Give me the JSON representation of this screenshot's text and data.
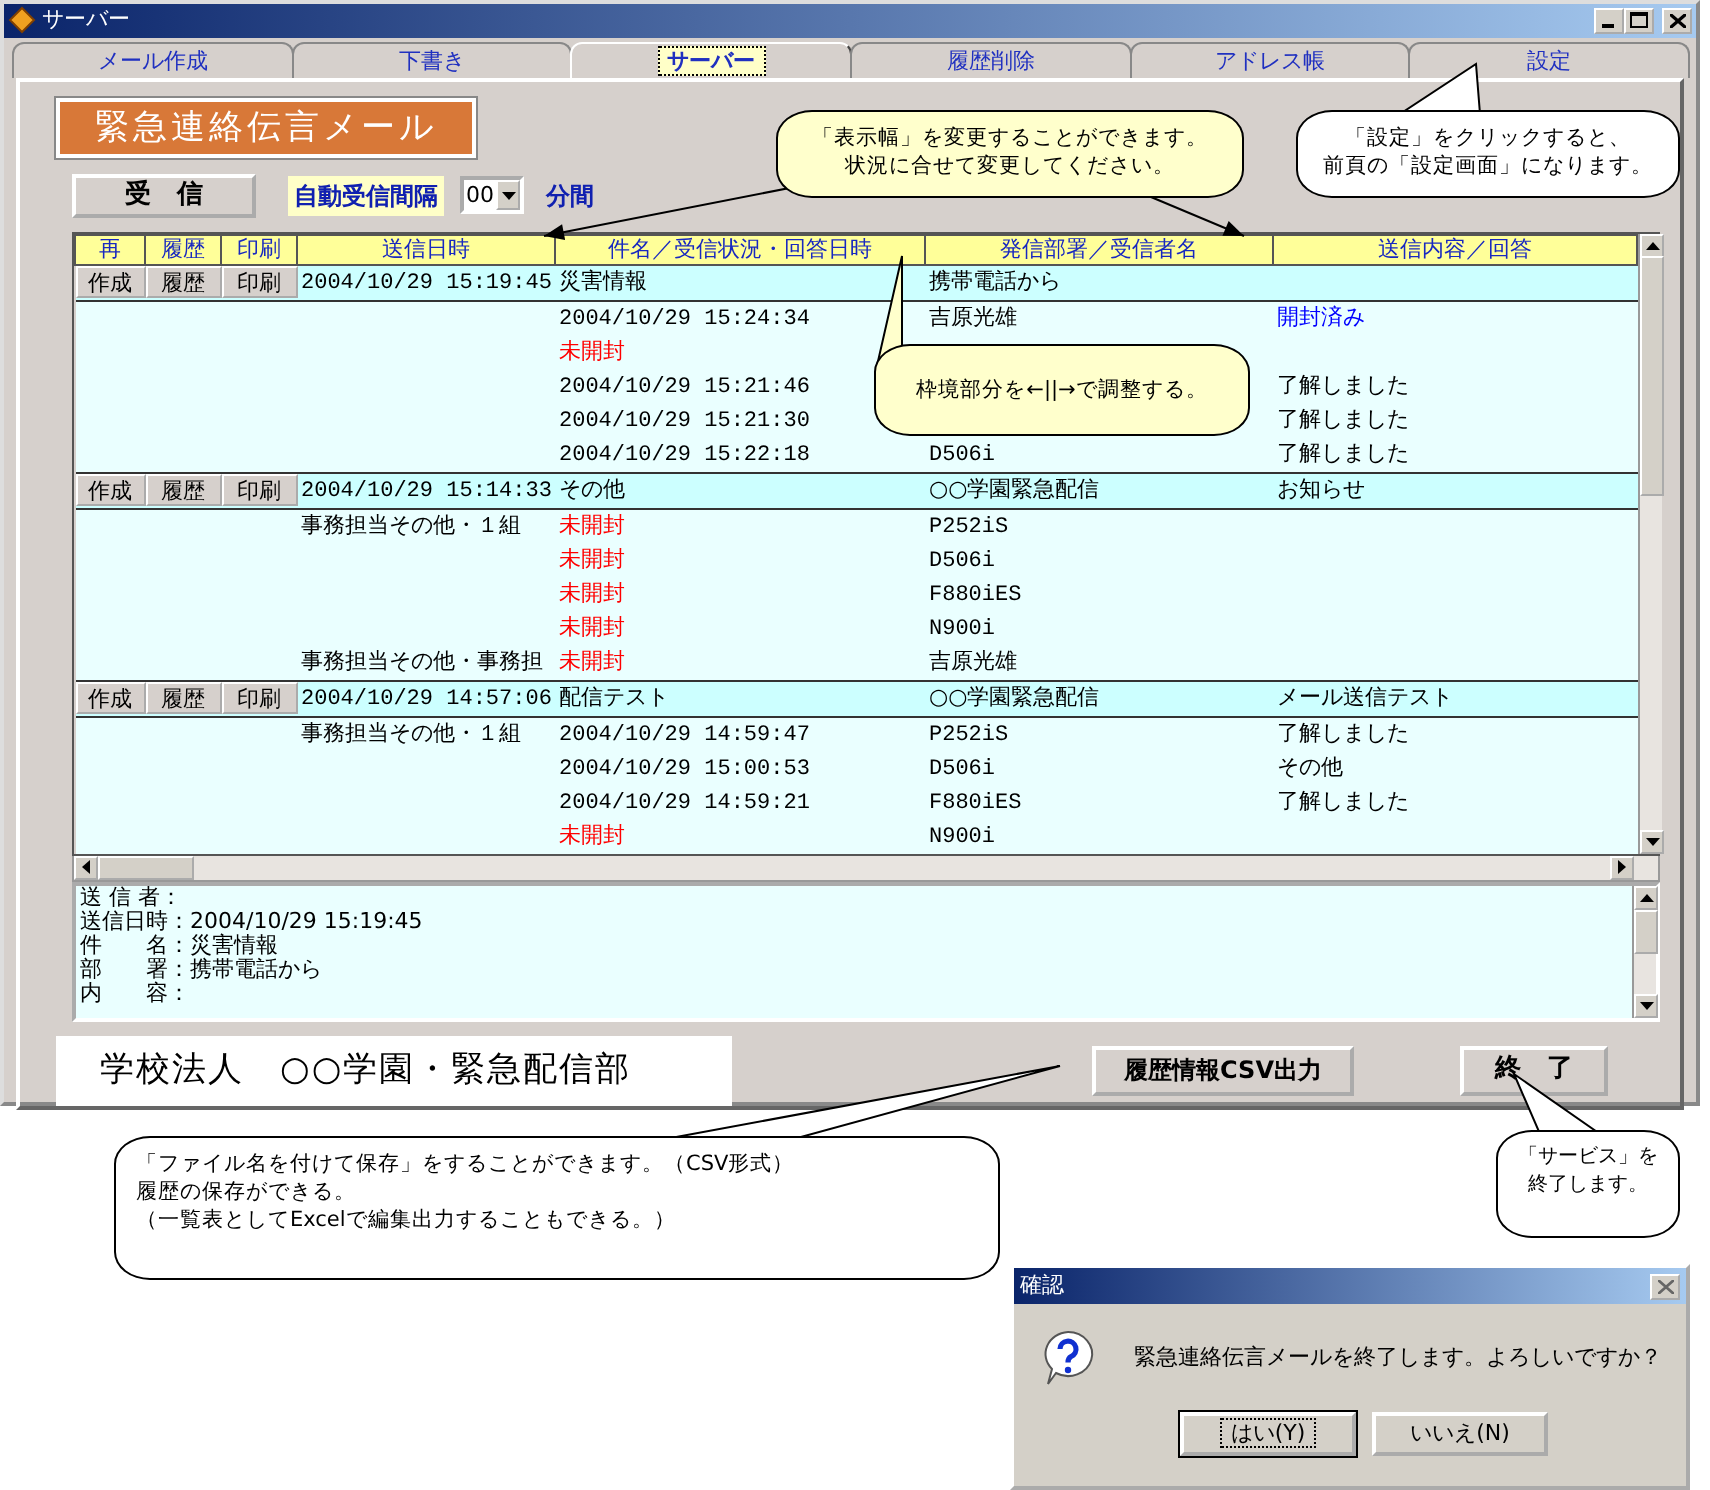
{
  "window": {
    "title": "サーバー"
  },
  "tabs": [
    {
      "label": "メール作成",
      "selected": false
    },
    {
      "label": "下書き",
      "selected": false
    },
    {
      "label": "サーバー",
      "selected": true
    },
    {
      "label": "履歴削除",
      "selected": false
    },
    {
      "label": "アドレス帳",
      "selected": false
    },
    {
      "label": "設定",
      "selected": false
    }
  ],
  "header": {
    "banner": "緊急連絡伝言メール",
    "receive_button": "受　信",
    "interval_label": "自動受信間隔",
    "interval_value": "00",
    "interval_unit": "分間"
  },
  "table": {
    "columns": [
      "再",
      "履歴",
      "印刷",
      "送信日時",
      "件名／受信状況・回答日時",
      "発信部署／受信者名",
      "送信内容／回答"
    ],
    "groups": [
      {
        "buttons": [
          "作成",
          "履歴",
          "印刷"
        ],
        "sent": "2004/10/29 15:19:45",
        "subject": "災害情報",
        "sender": "携帯電話から",
        "rows": [
          {
            "status": {
              "text": "2004/10/29 15:24:34",
              "kind": "time"
            },
            "recipient": "吉原光雄",
            "reply": {
              "text": "開封済み",
              "kind": "opened"
            }
          },
          {
            "status": {
              "text": "未開封",
              "kind": "unopened"
            }
          },
          {
            "status": {
              "text": "2004/10/29 15:21:46",
              "kind": "time"
            },
            "reply": {
              "text": "了解しました",
              "kind": "answer"
            }
          },
          {
            "status": {
              "text": "2004/10/29 15:21:30",
              "kind": "time"
            },
            "reply": {
              "text": "了解しました",
              "kind": "answer"
            }
          },
          {
            "status": {
              "text": "2004/10/29 15:22:18",
              "kind": "time"
            },
            "recipient": "D506i",
            "reply": {
              "text": "了解しました",
              "kind": "answer"
            }
          }
        ]
      },
      {
        "buttons": [
          "作成",
          "履歴",
          "印刷"
        ],
        "sent": "2004/10/29 15:14:33",
        "subject": "その他",
        "sender": "○○学園緊急配信",
        "content": "お知らせ",
        "rows": [
          {
            "group": "事務担当その他・１組",
            "status": {
              "text": "未開封",
              "kind": "unopened"
            },
            "recipient": "P252iS"
          },
          {
            "status": {
              "text": "未開封",
              "kind": "unopened"
            },
            "recipient": "D506i"
          },
          {
            "status": {
              "text": "未開封",
              "kind": "unopened"
            },
            "recipient": "F880iES"
          },
          {
            "status": {
              "text": "未開封",
              "kind": "unopened"
            },
            "recipient": "N900i"
          },
          {
            "group": "事務担当その他・事務担",
            "status": {
              "text": "未開封",
              "kind": "unopened"
            },
            "recipient": "吉原光雄"
          }
        ]
      },
      {
        "buttons": [
          "作成",
          "履歴",
          "印刷"
        ],
        "sent": "2004/10/29 14:57:06",
        "subject": "配信テスト",
        "sender": "○○学園緊急配信",
        "content": "メール送信テスト",
        "rows": [
          {
            "group": "事務担当その他・１組",
            "status": {
              "text": "2004/10/29 14:59:47",
              "kind": "time"
            },
            "recipient": "P252iS",
            "reply": {
              "text": "了解しました",
              "kind": "answer"
            }
          },
          {
            "status": {
              "text": "2004/10/29 15:00:53",
              "kind": "time"
            },
            "recipient": "D506i",
            "reply": {
              "text": "その他",
              "kind": "answer"
            }
          },
          {
            "status": {
              "text": "2004/10/29 14:59:21",
              "kind": "time"
            },
            "recipient": "F880iES",
            "reply": {
              "text": "了解しました",
              "kind": "answer"
            }
          },
          {
            "status": {
              "text": "未開封",
              "kind": "unopened"
            },
            "recipient": "N900i"
          }
        ]
      }
    ]
  },
  "detail": {
    "lines": [
      "送 信 者：",
      "送信日時：2004/10/29 15:19:45",
      "件　　名：災害情報",
      "部　　署：携帯電話から",
      "内　　容："
    ]
  },
  "footer": {
    "organization": "学校法人　○○学園・緊急配信部",
    "csv_button": "履歴情報CSV出力",
    "exit_button": "終　了"
  },
  "callouts": [
    {
      "lines": [
        "「表示幅」を変更することができます。",
        "状況に合せて変更してください。"
      ],
      "color": "#ffffcc"
    },
    {
      "lines": [
        "「設定」をクリックすると、",
        "前頁の「設定画面」になります。"
      ],
      "color": "#ffffff"
    },
    {
      "lines": [
        "枠境部分を←||→で調整する。"
      ],
      "color": "#ffffcc"
    },
    {
      "lines": [
        "「ファイル名を付けて保存」をすることができます。（CSV形式）",
        "履歴の保存ができる。",
        "（一覧表としてExcelで編集出力することもできる。）"
      ],
      "color": "#ffffff"
    },
    {
      "lines": [
        "「サービス」を",
        "終了します。"
      ],
      "color": "#ffffff"
    }
  ],
  "dialog": {
    "title": "確認",
    "message": "緊急連絡伝言メールを終了します。よろしいですか？",
    "buttons": [
      {
        "label": "はい(Y)",
        "default": true
      },
      {
        "label": "いいえ(N)",
        "default": false
      }
    ]
  }
}
